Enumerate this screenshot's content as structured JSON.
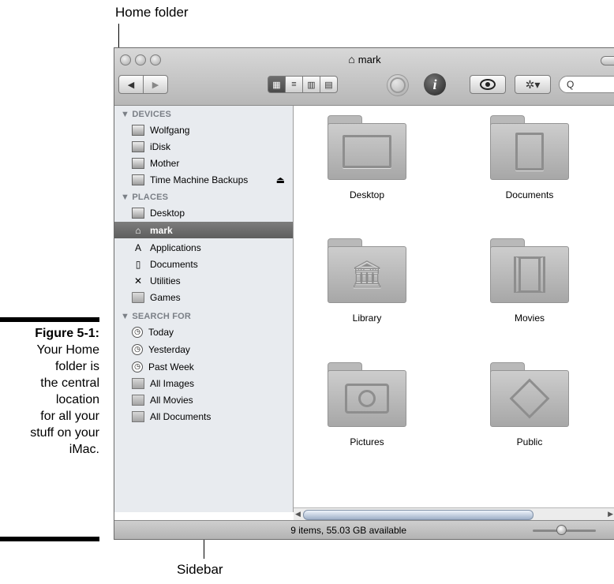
{
  "callouts": {
    "home_folder": "Home folder",
    "sidebar": "Sidebar"
  },
  "caption": {
    "label": "Figure 5-1:",
    "lines": [
      "Your Home",
      "folder is",
      "the central",
      "location",
      "for all your",
      "stuff on your",
      "iMac."
    ]
  },
  "window": {
    "title": "mark",
    "title_icon": "house-icon"
  },
  "toolbar": {
    "back": "◀",
    "forward": "▶",
    "info": "i",
    "action": "✲▾",
    "search_placeholder": "Q"
  },
  "sidebar": {
    "devices_header": "▼ DEVICES",
    "places_header": "▼ PLACES",
    "search_header": "▼ SEARCH FOR",
    "devices": [
      {
        "label": "Wolfgang",
        "icon": "hard-disk-icon"
      },
      {
        "label": "iDisk",
        "icon": "idisk-icon"
      },
      {
        "label": "Mother",
        "icon": "hard-disk-icon"
      },
      {
        "label": "Time Machine Backups",
        "icon": "time-machine-disk-icon"
      }
    ],
    "eject": "⏏",
    "places": [
      {
        "label": "Desktop",
        "icon": "desktop-icon"
      },
      {
        "label": "mark",
        "icon": "home-icon"
      },
      {
        "label": "Applications",
        "icon": "applications-icon"
      },
      {
        "label": "Documents",
        "icon": "document-icon"
      },
      {
        "label": "Utilities",
        "icon": "utilities-icon"
      },
      {
        "label": "Games",
        "icon": "folder-icon"
      }
    ],
    "searches": [
      {
        "label": "Today",
        "icon": "clock-icon"
      },
      {
        "label": "Yesterday",
        "icon": "clock-icon"
      },
      {
        "label": "Past Week",
        "icon": "clock-icon"
      },
      {
        "label": "All Images",
        "icon": "smart-folder-icon"
      },
      {
        "label": "All Movies",
        "icon": "smart-folder-icon"
      },
      {
        "label": "All Documents",
        "icon": "smart-folder-icon"
      }
    ]
  },
  "content": {
    "folders": [
      {
        "label": "Desktop",
        "icon": "desktop-folder-icon"
      },
      {
        "label": "Documents",
        "icon": "documents-folder-icon"
      },
      {
        "label": "Library",
        "icon": "library-folder-icon"
      },
      {
        "label": "Movies",
        "icon": "movies-folder-icon"
      },
      {
        "label": "Pictures",
        "icon": "pictures-folder-icon"
      },
      {
        "label": "Public",
        "icon": "public-folder-icon"
      }
    ]
  },
  "status": {
    "text": "9 items, 55.03 GB available"
  }
}
